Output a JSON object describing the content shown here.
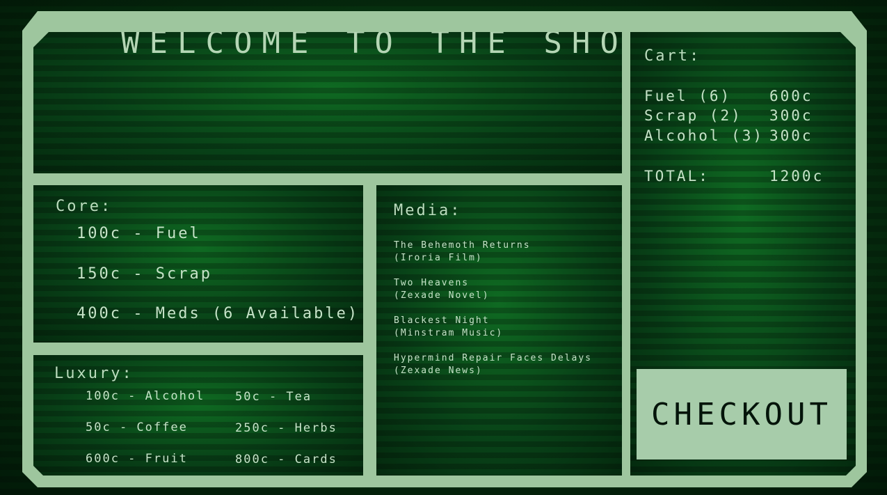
{
  "title": "WELCOME TO THE SHOP",
  "core": {
    "heading": "Core:",
    "items": [
      "100c - Fuel",
      "150c - Scrap",
      "400c - Meds (6 Available)"
    ]
  },
  "luxury": {
    "heading": "Luxury:",
    "items": [
      "100c - Alcohol",
      "50c - Tea",
      "50c - Coffee",
      "250c - Herbs",
      "600c - Fruit",
      "800c - Cards"
    ]
  },
  "media": {
    "heading": "Media:",
    "items": [
      {
        "name": "The Behemoth Returns",
        "source": "(Iroria Film)"
      },
      {
        "name": "Two Heavens",
        "source": "(Zexade Novel)"
      },
      {
        "name": "Blackest Night",
        "source": "(Minstram Music)"
      },
      {
        "name": "Hypermind Repair Faces Delays",
        "source": "(Zexade News)"
      }
    ]
  },
  "cart": {
    "heading": "Cart:",
    "rows": [
      {
        "item": "Fuel (6)",
        "price": "600c"
      },
      {
        "item": "Scrap (2)",
        "price": "300c"
      },
      {
        "item": "Alcohol (3)",
        "price": "300c"
      }
    ],
    "total_label": "TOTAL:",
    "total_value": "1200c",
    "checkout_label": "CHECKOUT"
  },
  "colors": {
    "frame": "#9ec69e",
    "panel": "#0a4a18",
    "text": "#c6e3c8",
    "button": "#a7ccaa"
  }
}
